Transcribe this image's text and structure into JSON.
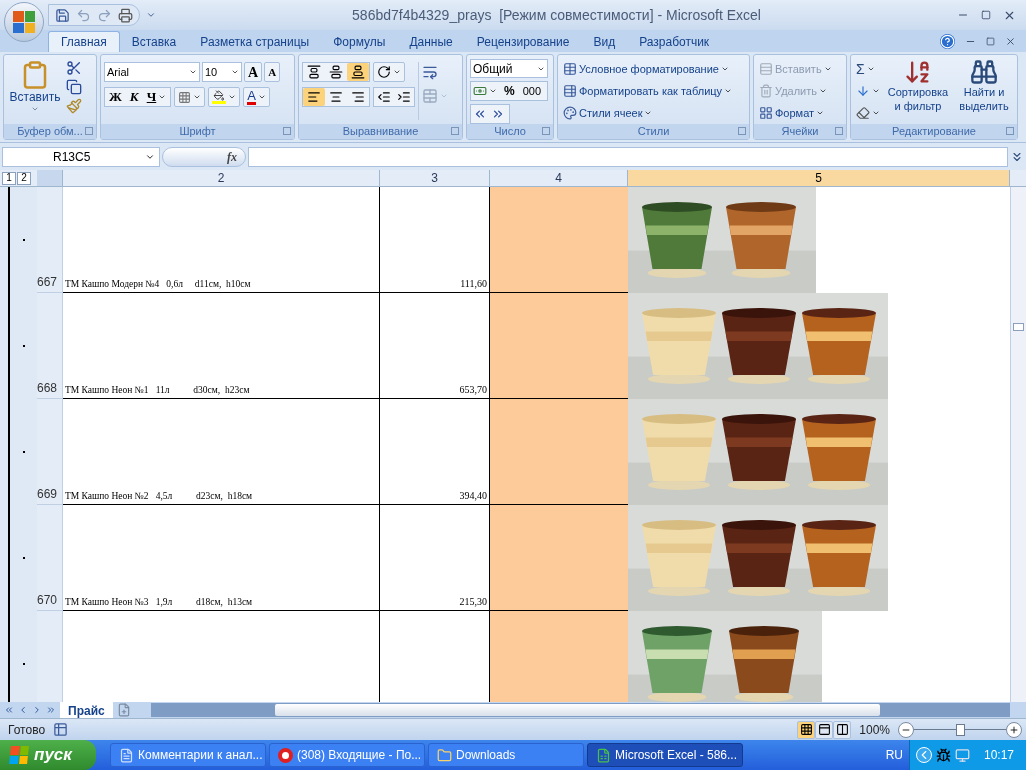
{
  "window": {
    "title": "586bd7f4b4329_prays  [Режим совместимости] - Microsoft Excel"
  },
  "ribbon_tabs": [
    {
      "label": "Главная",
      "selected": true
    },
    {
      "label": "Вставка",
      "selected": false
    },
    {
      "label": "Разметка страницы",
      "selected": false
    },
    {
      "label": "Формулы",
      "selected": false
    },
    {
      "label": "Данные",
      "selected": false
    },
    {
      "label": "Рецензирование",
      "selected": false
    },
    {
      "label": "Вид",
      "selected": false
    },
    {
      "label": "Разработчик",
      "selected": false
    }
  ],
  "clipboard": {
    "label": "Буфер обм...",
    "paste": "Вставить"
  },
  "font": {
    "label": "Шрифт",
    "family": "Arial",
    "size": "10",
    "grow": "A",
    "shrink": "A",
    "bold": "Ж",
    "italic": "К",
    "underline": "Ч",
    "font_color": "A"
  },
  "alignment": {
    "label": "Выравнивание",
    "vertical": [
      {
        "selected": false
      },
      {
        "selected": false
      },
      {
        "selected": true
      }
    ],
    "horizontal": [
      {
        "selected": true
      },
      {
        "selected": false
      },
      {
        "selected": false
      }
    ]
  },
  "number": {
    "label": "Число",
    "format": "Общий",
    "percent": "%",
    "thousands": "000"
  },
  "styles": {
    "label": "Стили",
    "items": [
      "Условное форматирование",
      "Форматировать как таблицу",
      "Стили ячеек"
    ]
  },
  "cells": {
    "label": "Ячейки",
    "items": [
      {
        "label": "Вставить",
        "disabled": true
      },
      {
        "label": "Удалить",
        "disabled": true
      },
      {
        "label": "Формат",
        "disabled": false
      }
    ]
  },
  "editing": {
    "label": "Редактирование",
    "sigma": "Σ",
    "sort": [
      "Сортировка",
      "и фильтр"
    ],
    "find": [
      "Найти и",
      "выделить"
    ]
  },
  "name_box": "R13C5",
  "fx": "fx",
  "outline_levels": [
    "1",
    "2"
  ],
  "columns": [
    {
      "label": "2",
      "selected": false
    },
    {
      "label": "3",
      "selected": false
    },
    {
      "label": "4",
      "selected": false
    },
    {
      "label": "5",
      "selected": true
    }
  ],
  "rows": [
    {
      "number": "667",
      "item": "ТМ Кашпо Модерн №4   0,6л     d11см,  h10см",
      "price": "111,60",
      "picture": {
        "kind": "picture"
      }
    },
    {
      "number": "668",
      "item": "ТМ Кашпо Неон №1   11л          d30см,  h23см",
      "price": "653,70",
      "picture": {
        "kind": "picture"
      }
    },
    {
      "number": "669",
      "item": "ТМ Кашпо Неон №2   4,5л          d23см,  h18см",
      "price": "394,40",
      "picture": {
        "kind": "picture"
      }
    },
    {
      "number": "670",
      "item": "ТМ Кашпо Неон №3   1,9л          d18см,  h13см",
      "price": "215,30",
      "picture": {
        "kind": "picture"
      }
    },
    {
      "picture": {
        "kind": "picture"
      }
    }
  ],
  "sheet_tabs": [
    {
      "label": "Прайс",
      "selected": true
    }
  ],
  "status_bar": {
    "status": "Готово",
    "views": [
      {
        "selected": true
      },
      {
        "selected": false
      },
      {
        "selected": false
      }
    ],
    "zoom": "100%",
    "zoom_level": {
      "level": 0.5
    }
  },
  "taskbar": {
    "start": "пуск",
    "tasks": [
      {
        "kind": "word",
        "label": "Комментарии к анал...",
        "selected": false
      },
      {
        "kind": "browser",
        "label": "(308) Входящие - По...",
        "selected": false
      },
      {
        "kind": "folder",
        "label": "Downloads",
        "selected": false
      },
      {
        "kind": "excel",
        "label": "Microsoft Excel - 586...",
        "selected": true
      }
    ],
    "language": "RU",
    "time": "10:17"
  }
}
